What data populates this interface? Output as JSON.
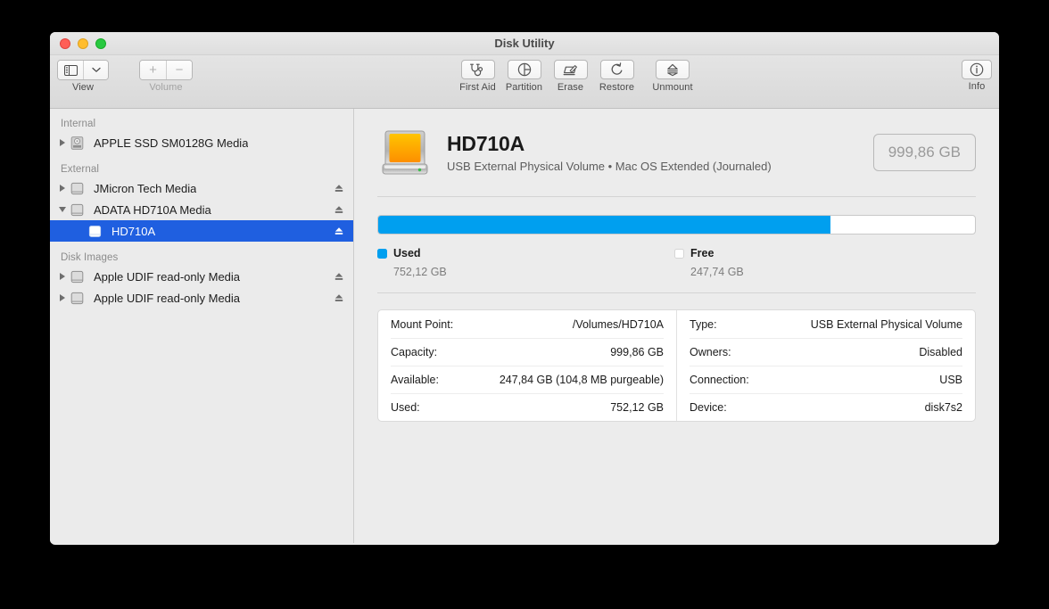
{
  "window": {
    "title": "Disk Utility",
    "controls": [
      "close",
      "minimize",
      "zoom"
    ]
  },
  "toolbar": {
    "view_caption": "View",
    "volume_caption": "Volume",
    "volume_add": "+",
    "volume_remove": "−",
    "buttons": [
      {
        "label": "First Aid",
        "icon": "stethoscope-icon"
      },
      {
        "label": "Partition",
        "icon": "pie-chart-icon"
      },
      {
        "label": "Erase",
        "icon": "erase-icon"
      },
      {
        "label": "Restore",
        "icon": "restore-icon"
      },
      {
        "label": "Unmount",
        "icon": "eject-icon"
      }
    ],
    "info_label": "Info"
  },
  "sidebar": {
    "groups": [
      {
        "header": "Internal",
        "items": [
          {
            "label": "APPLE SSD SM0128G Media",
            "icon": "internal-drive-icon",
            "disclosure": "collapsed",
            "eject": false,
            "selected": false,
            "indent": false
          }
        ]
      },
      {
        "header": "External",
        "items": [
          {
            "label": "JMicron Tech Media",
            "icon": "external-drive-icon",
            "disclosure": "collapsed",
            "eject": true,
            "selected": false,
            "indent": false
          },
          {
            "label": "ADATA HD710A Media",
            "icon": "external-drive-icon",
            "disclosure": "expanded",
            "eject": true,
            "selected": false,
            "indent": false
          },
          {
            "label": "HD710A",
            "icon": "volume-icon",
            "disclosure": "none",
            "eject": true,
            "selected": true,
            "indent": true
          }
        ]
      },
      {
        "header": "Disk Images",
        "items": [
          {
            "label": "Apple UDIF read-only Media",
            "icon": "external-drive-icon",
            "disclosure": "collapsed",
            "eject": true,
            "selected": false,
            "indent": false
          },
          {
            "label": "Apple UDIF read-only Media",
            "icon": "external-drive-icon",
            "disclosure": "collapsed",
            "eject": true,
            "selected": false,
            "indent": false
          }
        ]
      }
    ]
  },
  "detail": {
    "volume_name": "HD710A",
    "volume_subtitle": "USB External Physical Volume • Mac OS Extended (Journaled)",
    "capacity_badge": "999,86 GB",
    "icon": "external-hard-drive-icon",
    "usage": {
      "used_percent": 75.8,
      "used_label": "Used",
      "used_value": "752,12 GB",
      "free_label": "Free",
      "free_value": "247,74 GB",
      "used_color": "#009fef",
      "free_color": "#ffffff"
    },
    "info_left": [
      {
        "key": "Mount Point:",
        "value": "/Volumes/HD710A"
      },
      {
        "key": "Capacity:",
        "value": "999,86 GB"
      },
      {
        "key": "Available:",
        "value": "247,84 GB (104,8 MB purgeable)"
      },
      {
        "key": "Used:",
        "value": "752,12 GB"
      }
    ],
    "info_right": [
      {
        "key": "Type:",
        "value": "USB External Physical Volume"
      },
      {
        "key": "Owners:",
        "value": "Disabled"
      },
      {
        "key": "Connection:",
        "value": "USB"
      },
      {
        "key": "Device:",
        "value": "disk7s2"
      }
    ]
  }
}
